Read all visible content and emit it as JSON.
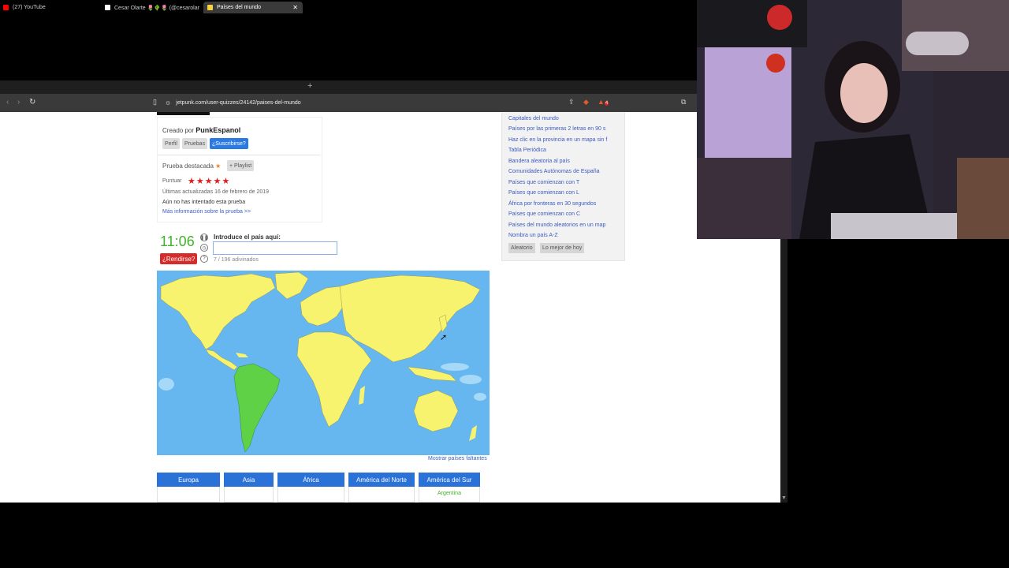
{
  "browser": {
    "tabs": [
      {
        "label": "(27) YouTube",
        "color": "#ff0000"
      },
      {
        "label": "Cesar Olarte 🌷🌵🌷 (@cesarolarte)",
        "color": "#ffffff"
      },
      {
        "label": "Países del mundo",
        "color": "#f6d33c",
        "active": true
      }
    ],
    "url": "jetpunk.com/user-quizzes/24142/paises-del-mundo",
    "ext_badge": "4"
  },
  "quiz_info": {
    "created_by_label": "Creado por",
    "author": "PunkEspanol",
    "btn_profile": "Perfil",
    "btn_tests": "Pruebas",
    "btn_subscribe": "¿Suscribirse?",
    "featured_label": "Prueba destacada",
    "playlist_btn": "+ Playlist",
    "score_label": "Puntuar",
    "stars": "★★★★★",
    "updated": "Últimas actualizadas  16 de febrero de 2019",
    "not_attempted": "Aún no has intentado esta prueba",
    "more_info": "Más información sobre la prueba >>"
  },
  "game": {
    "timer": "11:06",
    "surrender": "¿Rendirse?",
    "prompt": "Introduce el país aquí:",
    "input_value": "",
    "guessed": "7 / 196 adivinados",
    "show_missing": "Mostrar países faltantes"
  },
  "sidebar": {
    "links": [
      "Capitales del mundo",
      "Países por las primeras 2 letras en 90 s",
      "Haz clic en la provincia en un mapa sin f",
      "Tabla Periódica",
      "Bandera aleatoria al país",
      "Comunidades Autónomas de España",
      "Países que comienzan con T",
      "Países que comienzan con L",
      "África por fronteras en 30 segundos",
      "Países que comienzan con C",
      "Países del mundo aleatorios en un map",
      "Nombra un país A-Z"
    ],
    "btn_random": "Aleatorio",
    "btn_best": "Lo mejor de hoy"
  },
  "continents": [
    {
      "name": "Europa",
      "answers": []
    },
    {
      "name": "Asia",
      "answers": []
    },
    {
      "name": "África",
      "answers": []
    },
    {
      "name": "América del Norte",
      "answers": []
    },
    {
      "name": "América del Sur",
      "answers": [
        "Argentina"
      ]
    }
  ],
  "colors": {
    "ocean": "#66b6f0",
    "land": "#f8f36e",
    "guessed_land": "#5fd147",
    "accent": "#2a72d8",
    "timer": "#43b22c",
    "surrender": "#d62b2b"
  }
}
